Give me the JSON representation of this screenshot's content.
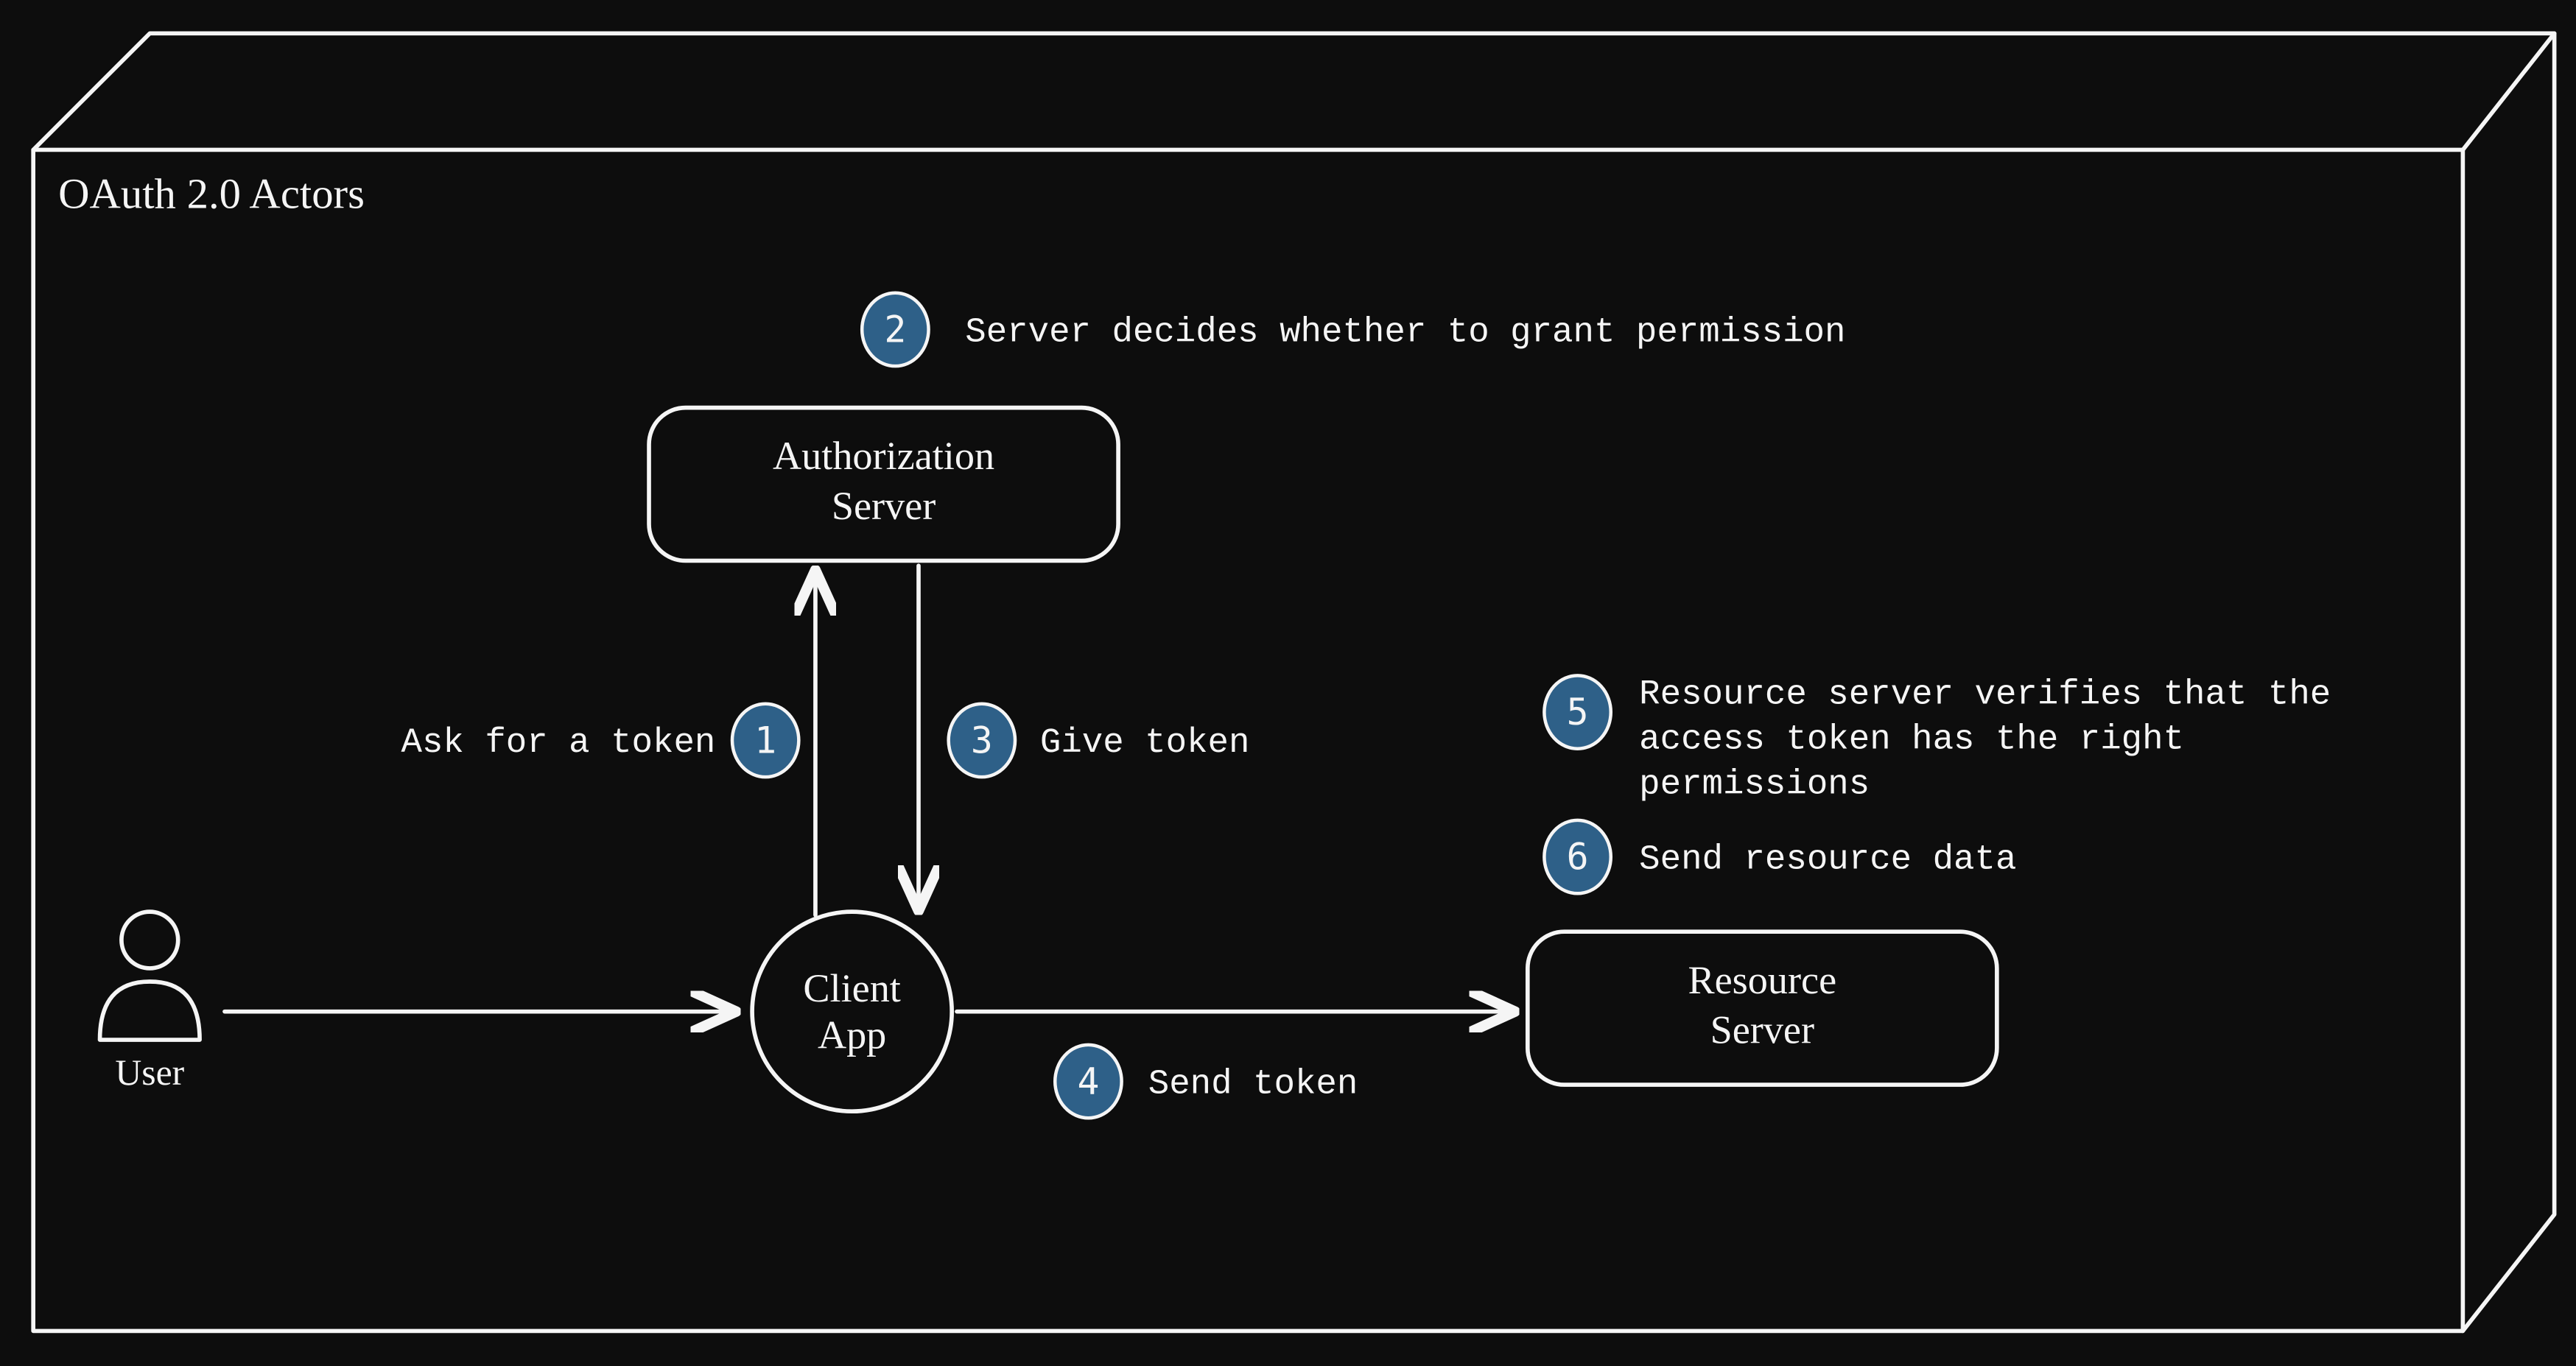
{
  "title": "OAuth 2.0 Actors",
  "actors": {
    "user": "User",
    "client_line1": "Client",
    "client_line2": "App",
    "auth_line1": "Authorization",
    "auth_line2": "Server",
    "resource_line1": "Resource",
    "resource_line2": "Server"
  },
  "steps": {
    "s1": {
      "num": "1",
      "label": "Ask for a token"
    },
    "s2": {
      "num": "2",
      "label": "Server decides whether to grant permission"
    },
    "s3": {
      "num": "3",
      "label": "Give token"
    },
    "s4": {
      "num": "4",
      "label": "Send token"
    },
    "s5": {
      "num": "5",
      "label": "Resource server verifies that the access token has the right permissions"
    },
    "s5_l1": "Resource server verifies that the",
    "s5_l2": "access token has the right",
    "s5_l3": "permissions",
    "s6": {
      "num": "6",
      "label": "Send resource data"
    }
  },
  "colors": {
    "bg": "#0d0d0d",
    "line": "#f5f5f5",
    "badge": "#2e6088"
  }
}
